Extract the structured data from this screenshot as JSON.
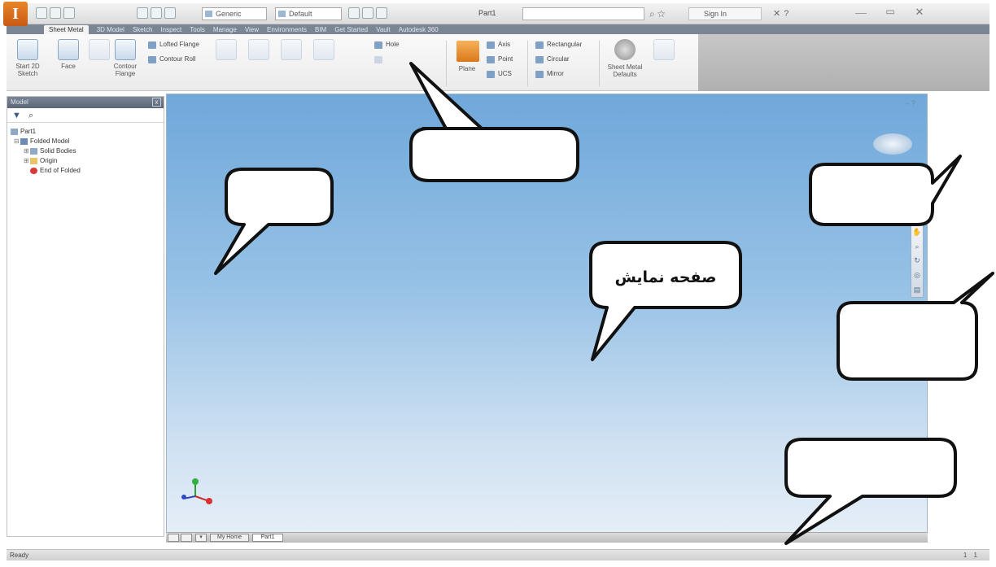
{
  "titlebar": {
    "app_logo": "I",
    "material_combo": "Generic",
    "appearance_combo": "Default",
    "doc_title": "Part1",
    "signin": "Sign In",
    "minimize": "—",
    "maximize": "▭",
    "close": "✕"
  },
  "ribbon": {
    "tabs": [
      "Sheet Metal",
      "3D Model",
      "Sketch",
      "Inspect",
      "Tools",
      "Manage",
      "View",
      "Environments",
      "BIM",
      "Get Started",
      "Vault",
      "Autodesk 360"
    ],
    "buttons": {
      "start_sketch": "Start 2D Sketch",
      "face": "Face",
      "contour_flange": "Contour Flange",
      "lofted_flange": "Lofted Flange",
      "contour_roll": "Contour Roll",
      "hole": "Hole",
      "plane": "Plane",
      "axis": "Axis",
      "point": "Point",
      "ucs": "UCS",
      "rectangular": "Rectangular",
      "circular": "Circular",
      "mirror": "Mirror",
      "sheet_metal_defaults": "Sheet Metal Defaults"
    }
  },
  "browser": {
    "title": "Model",
    "close": "x",
    "filter_icon": "▼",
    "find_icon": "⌕",
    "tree": [
      {
        "label": "Part1",
        "icon": "part-icon"
      },
      {
        "label": "Folded Model",
        "icon": "sheet-metal-icon"
      },
      {
        "label": "Solid Bodies",
        "icon": "solid-bodies-icon"
      },
      {
        "label": "Origin",
        "icon": "folder-icon"
      },
      {
        "label": "End of Folded",
        "icon": "end-of-part-icon"
      }
    ]
  },
  "viewport": {
    "controls": "– ?",
    "nav_tools": [
      "✋",
      "⌕",
      "↻",
      "◎",
      "▤"
    ]
  },
  "doc_tabs": {
    "my_home": "My Home",
    "part1": "Part1"
  },
  "status": {
    "text": "Ready",
    "right": "1  1"
  },
  "callout": {
    "graphics_window_label": "صفحه نمایش"
  }
}
